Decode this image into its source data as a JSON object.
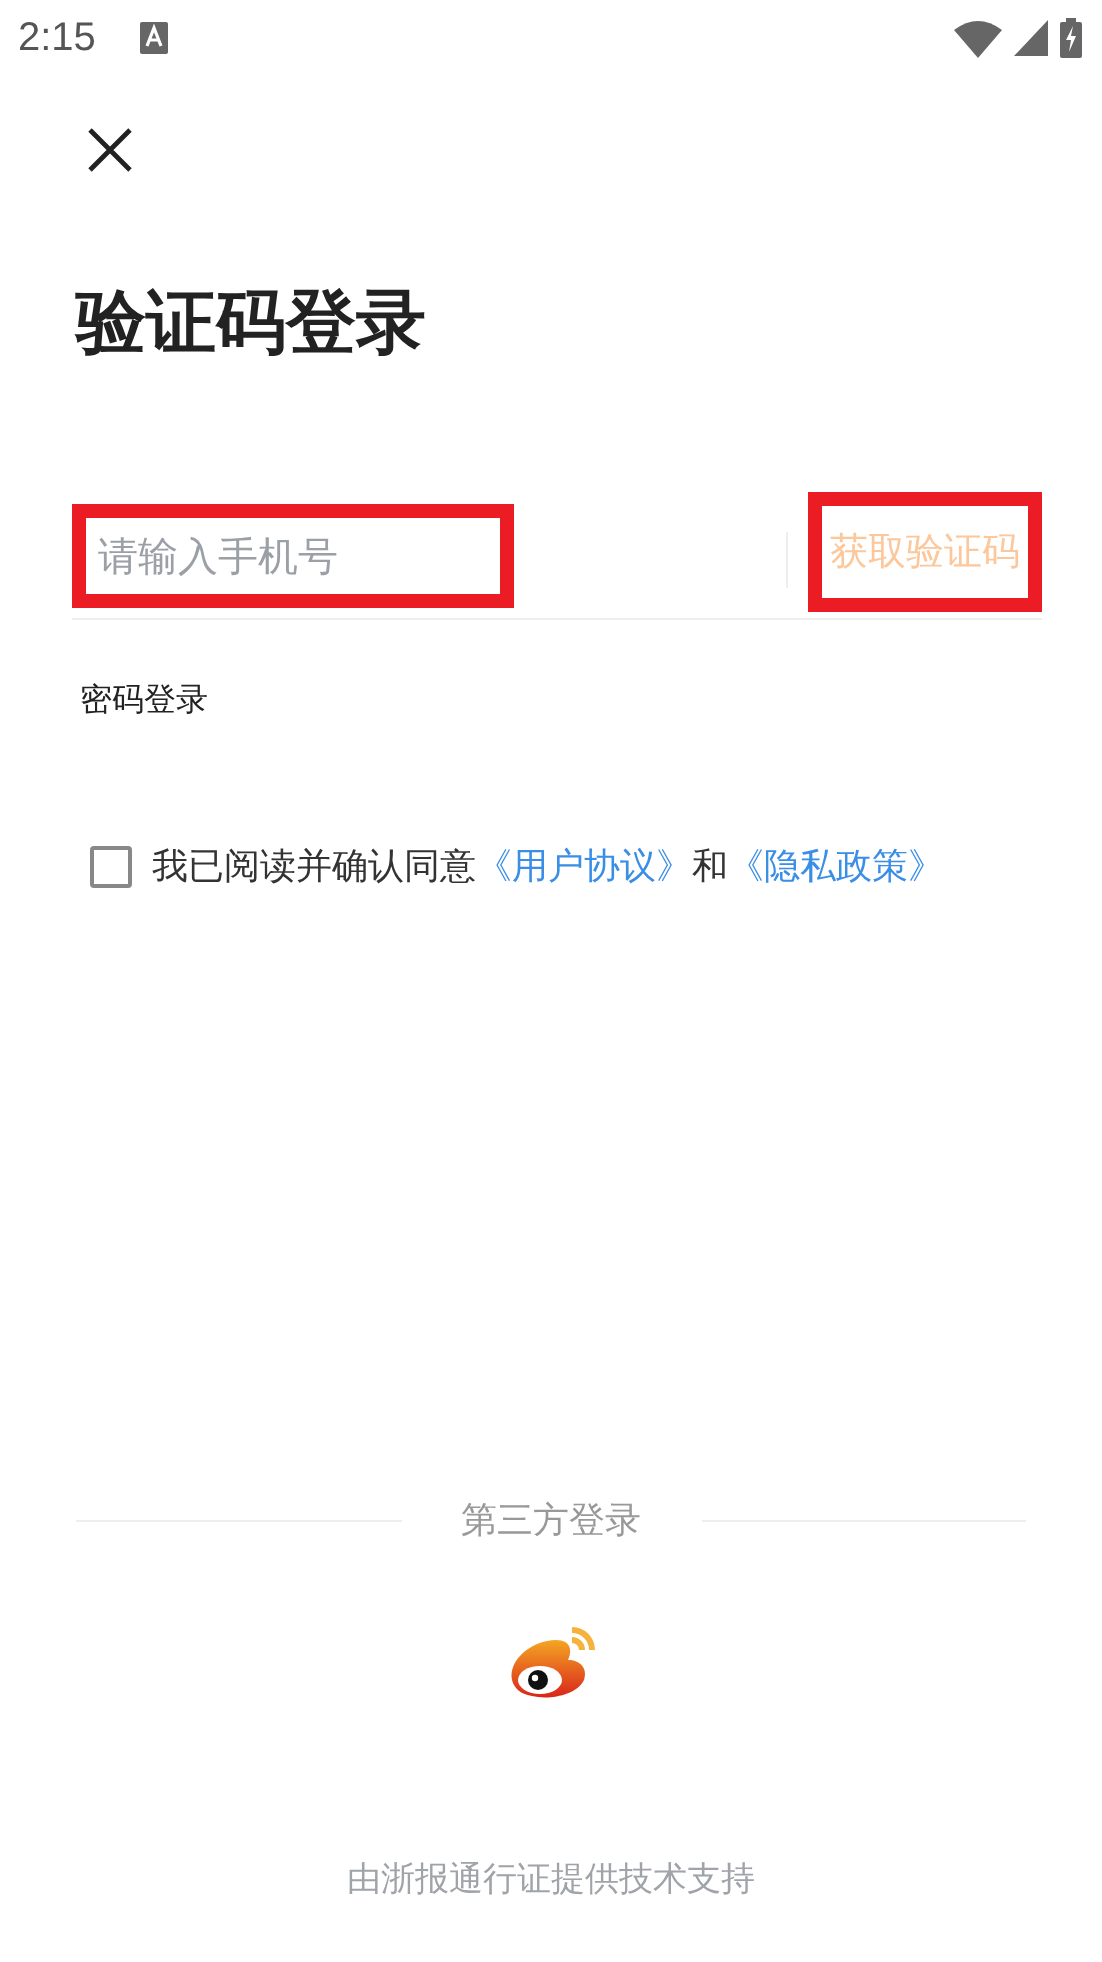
{
  "status_bar": {
    "time": "2:15"
  },
  "title": "验证码登录",
  "phone_field": {
    "placeholder": "请输入手机号",
    "highlighted": true
  },
  "code_button": {
    "label": "获取验证码",
    "highlighted": true
  },
  "password_login_link": "密码登录",
  "agreement": {
    "checked": false,
    "text": "我已阅读并确认同意",
    "link_1": "《用户协议》",
    "conjunction": "和",
    "link_2": "《隐私政策》"
  },
  "third_party": {
    "heading": "第三方登录"
  },
  "footer": "由浙报通行证提供技术支持"
}
